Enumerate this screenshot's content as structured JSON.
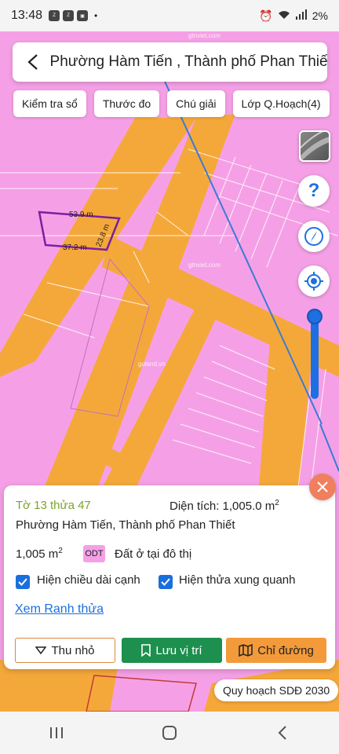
{
  "status_bar": {
    "time": "13:48",
    "apps": [
      "Zalo",
      "Zalo",
      "Gallery"
    ],
    "battery": "2%"
  },
  "header": {
    "title": "Phường Hàm Tiến , Thành phố Phan Thiết"
  },
  "chips": [
    {
      "label": "Kiểm tra sổ"
    },
    {
      "label": "Thước đo"
    },
    {
      "label": "Chú giải"
    },
    {
      "label": "Lớp Q.Hoạch(4)"
    }
  ],
  "map": {
    "parcel_edges": [
      "53.9 m",
      "23.8 m",
      "37.2 m"
    ],
    "watermarks": [
      "guland.vn",
      "gtnviet.com"
    ],
    "colors": {
      "residential": "#f5a0e6",
      "road": "#f5a83a",
      "parcel_border": "#7a1fa2",
      "blue_line": "#3a7bd5"
    }
  },
  "controls": {
    "help_icon": "question-icon",
    "compass_icon": "compass-icon",
    "locate_icon": "locate-icon",
    "zoom_level": 0.9
  },
  "panel": {
    "parcel_id": "Tờ 13 thửa 47",
    "area_label": "Diện tích: 1,005.0 m",
    "area_sup": "2",
    "address": "Phường Hàm Tiến, Thành phố Phan Thiết",
    "size": "1,005 m",
    "size_sup": "2",
    "landuse_code": "ODT",
    "landuse_name": "Đất ở tại đô thị",
    "checkbox_edges": "Hiện chiều dài cạnh",
    "checkbox_neighbors": "Hiện thửa xung quanh",
    "link_boundary": "Xem Ranh thửa",
    "btn_collapse": "Thu nhỏ",
    "btn_save": "Lưu vị trí",
    "btn_direction": "Chỉ đường"
  },
  "plan_label": "Quy hoạch SDĐ 2030"
}
